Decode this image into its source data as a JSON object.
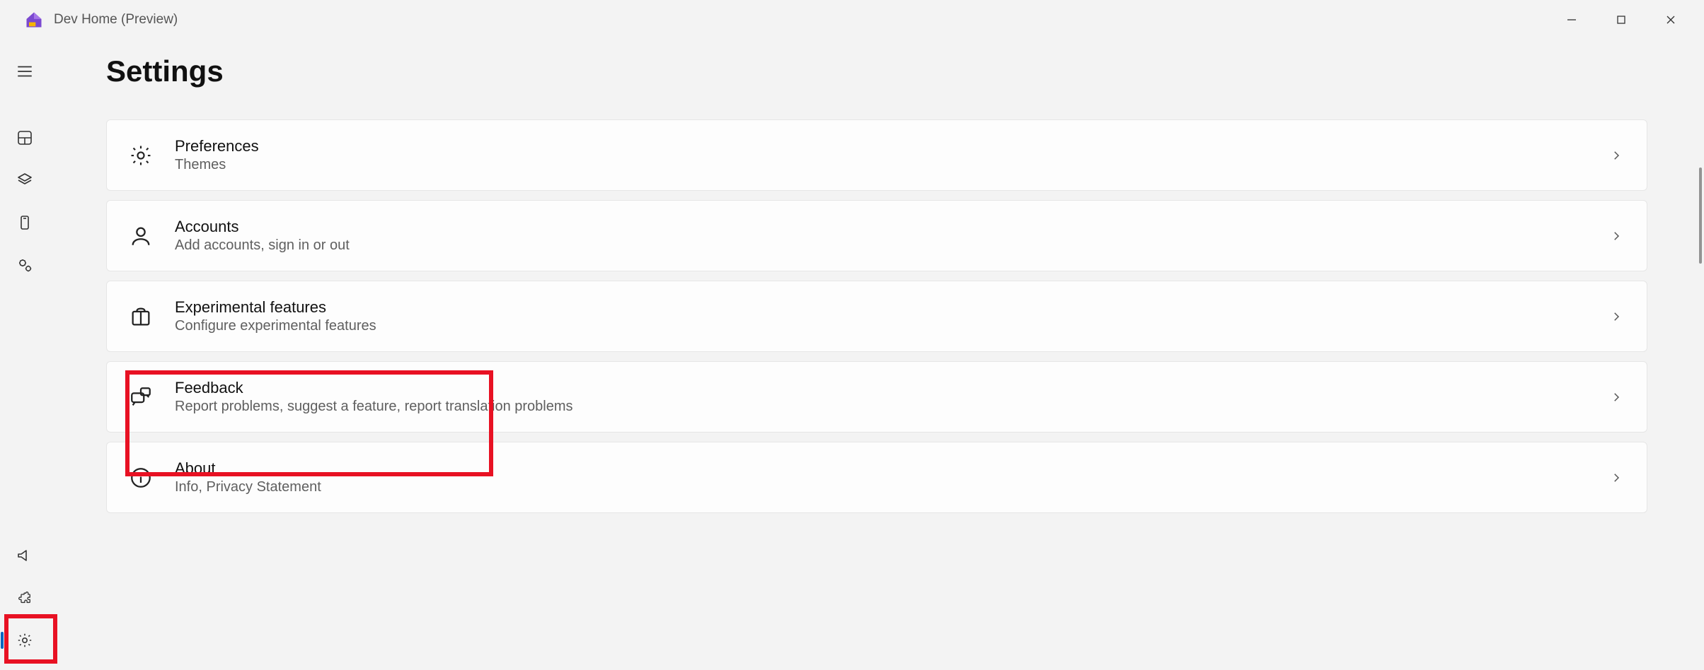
{
  "app": {
    "title": "Dev Home (Preview)"
  },
  "sidebar": {
    "top": [
      {
        "name": "hamburger-icon"
      },
      {
        "name": "dashboard-icon"
      },
      {
        "name": "layers-icon"
      },
      {
        "name": "device-icon"
      },
      {
        "name": "gears-icon"
      }
    ],
    "bottom": [
      {
        "name": "megaphone-icon"
      },
      {
        "name": "puzzle-icon"
      },
      {
        "name": "settings-icon",
        "active": true
      }
    ]
  },
  "page": {
    "title": "Settings"
  },
  "cards": [
    {
      "id": "preferences",
      "icon": "gear-icon",
      "title": "Preferences",
      "subtitle": "Themes"
    },
    {
      "id": "accounts",
      "icon": "person-icon",
      "title": "Accounts",
      "subtitle": "Add accounts, sign in or out"
    },
    {
      "id": "experimental",
      "icon": "box-icon",
      "title": "Experimental features",
      "subtitle": "Configure experimental features"
    },
    {
      "id": "feedback",
      "icon": "feedback-icon",
      "title": "Feedback",
      "subtitle": "Report problems, suggest a feature, report translation problems"
    },
    {
      "id": "about",
      "icon": "info-icon",
      "title": "About",
      "subtitle": "Info, Privacy Statement"
    }
  ]
}
